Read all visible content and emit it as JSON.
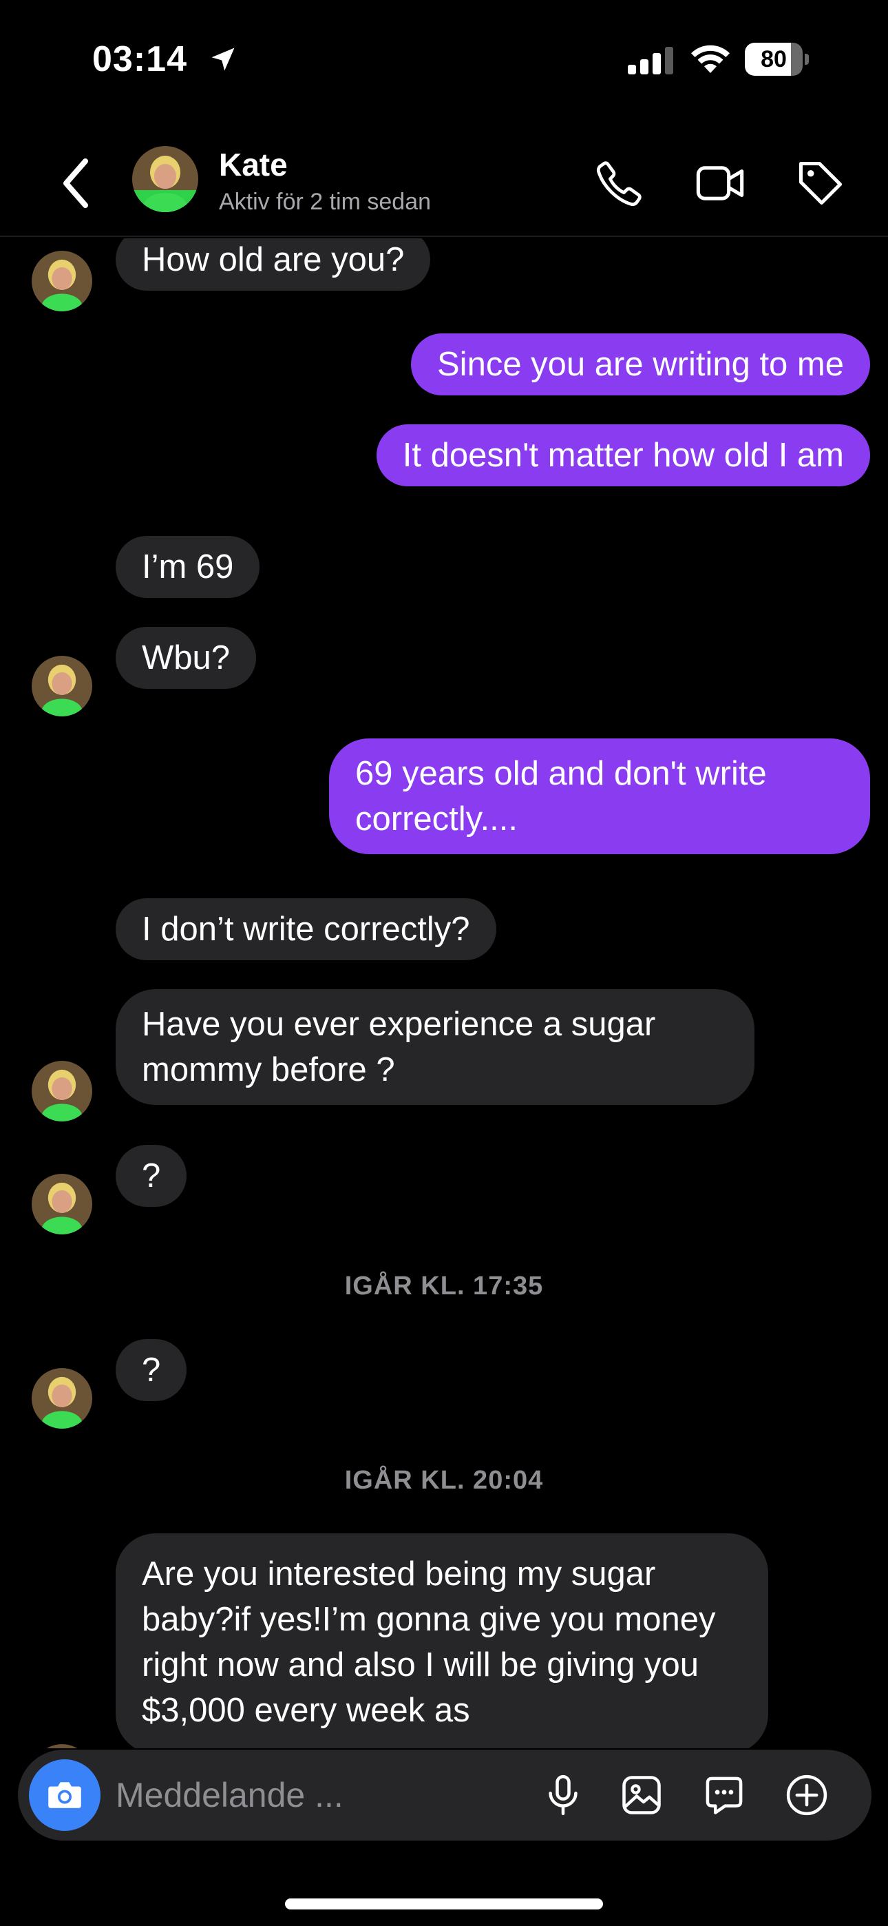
{
  "status_bar": {
    "time": "03:14",
    "battery_level": "80",
    "battery_fraction": 0.8
  },
  "header": {
    "contact_name": "Kate",
    "contact_status": "Aktiv för 2 tim sedan",
    "icons": [
      "back-chevron-icon",
      "phone-icon",
      "video-camera-icon",
      "tag-icon"
    ]
  },
  "messages": [
    {
      "from": "contact",
      "text": "How old are you?"
    },
    {
      "from": "me",
      "text": "Since you are writing to me"
    },
    {
      "from": "me",
      "text": "It doesn't matter how old I am"
    },
    {
      "from": "contact",
      "text": "I’m 69"
    },
    {
      "from": "contact",
      "text": "Wbu?"
    },
    {
      "from": "me",
      "text": "69 years old and don't write correctly...."
    },
    {
      "from": "contact",
      "text": "I don’t write correctly?"
    },
    {
      "from": "contact",
      "text": "Have you ever experience a sugar mommy before ?"
    },
    {
      "from": "contact",
      "text": "?"
    },
    {
      "timestamp": "IGÅR KL. 17:35"
    },
    {
      "from": "contact",
      "text": "?"
    },
    {
      "timestamp": "IGÅR KL. 20:04"
    },
    {
      "from": "contact",
      "text": "Are you interested being my sugar baby?if yes!I’m gonna give you money right now and also I will be giving you $3,000 every week as"
    }
  ],
  "composer": {
    "placeholder": "Meddelande ...",
    "icons": [
      "camera-icon",
      "microphone-icon",
      "image-icon",
      "sticker-icon",
      "plus-icon"
    ]
  },
  "colors": {
    "background": "#000000",
    "incoming_bubble": "#262628",
    "outgoing_bubble": "#8a3cf0",
    "camera_button": "#3a82f7"
  }
}
